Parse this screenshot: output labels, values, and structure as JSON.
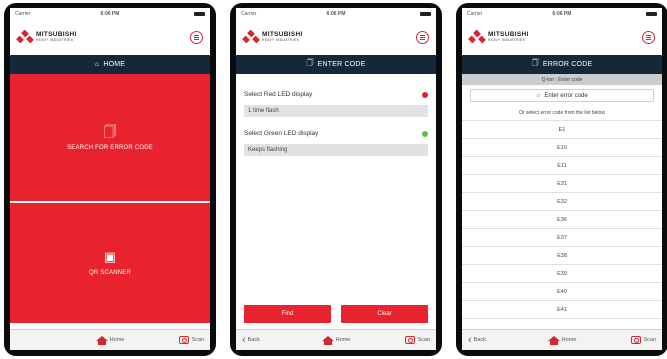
{
  "brand": {
    "name": "MITSUBISHI",
    "sub": "HEAVY INDUSTRIES"
  },
  "phone1": {
    "status": {
      "carrier": "Carrier",
      "time": "6:06 PM"
    },
    "title": "HOME",
    "search_label": "SEARCH FOR ERROR CODE",
    "qr_label": "QR SCANNER",
    "tabs": {
      "home": "Home",
      "scan": "Scan"
    }
  },
  "phone2": {
    "status": {
      "carrier": "Carrier",
      "time": "6:06 PM"
    },
    "title": "ENTER CODE",
    "red_label": "Select Red LED display",
    "red_value": "1 time flash",
    "green_label": "Select Green LED display",
    "green_value": "Keeps flashing",
    "find_label": "Find",
    "clear_label": "Clear",
    "tabs": {
      "back": "Back",
      "home": "Home",
      "scan": "Scan"
    },
    "colors": {
      "red_led": "#d7262f",
      "green_led": "#5fbf3f"
    }
  },
  "phone3": {
    "status": {
      "carrier": "Carrier",
      "time": "6:06 PM"
    },
    "title": "ERROR CODE",
    "subtitle": "Q-ton : Enter code",
    "search_placeholder": "Enter error code",
    "hint": "Or select error code from the list below",
    "codes": [
      "E1",
      "E10",
      "E11",
      "E31",
      "E32",
      "E36",
      "E37",
      "E38",
      "E39",
      "E40",
      "E41"
    ],
    "tabs": {
      "back": "Back",
      "home": "Home",
      "scan": "Scan"
    }
  },
  "colors": {
    "accent": "#e8232e",
    "navbar": "#14283a"
  }
}
